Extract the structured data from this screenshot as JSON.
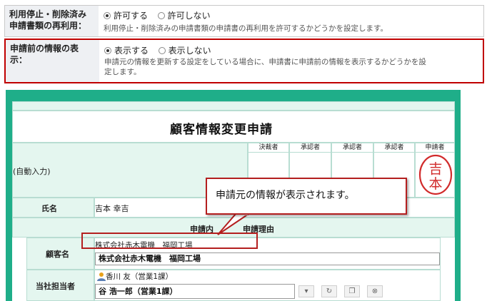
{
  "settings": [
    {
      "label_line1": "利用停止・削除済み",
      "label_line2": "申請書類の再利用：",
      "options": [
        {
          "label": "許可する",
          "selected": true
        },
        {
          "label": "許可しない",
          "selected": false
        }
      ],
      "description_line1": "利用停止・削除済みの申請書類の申請書の再利用を許可するかどうかを設定します。",
      "description_line2": ""
    },
    {
      "label_line1": "申請前の情報の表",
      "label_line2": "示：",
      "options": [
        {
          "label": "表示する",
          "selected": true
        },
        {
          "label": "表示しない",
          "selected": false
        }
      ],
      "description_line1": "申請元の情報を更新する設定をしている場合に、申請書に申請前の情報を表示するかどうかを設",
      "description_line2": "定します。"
    }
  ],
  "form": {
    "title": "顧客情報変更申請",
    "auto_input": "(自動入力)",
    "approvals": [
      "決裁者",
      "承認者",
      "承認者",
      "承認者",
      "申請者"
    ],
    "stamp": {
      "top": "吉",
      "bottom": "本",
      "color": "#d12b2b"
    },
    "name_label": "氏名",
    "name_value": "吉本 幸吉",
    "reason_header_left": "申請内",
    "reason_header_right": "申請理由",
    "customer_label": "顧客名",
    "customer_before": "株式会社赤木電機　福岡工場",
    "customer_value": "株式会社赤木電機　福岡工場",
    "staff_label": "当社担当者",
    "staff_before": "香川 友（営業1課）",
    "staff_value": "谷 浩一郎（営業1課）"
  },
  "callout": {
    "text": "申請元の情報が表示されます。"
  },
  "colors": {
    "accent_green": "#1fae89",
    "highlight_red": "#b41f1f"
  }
}
